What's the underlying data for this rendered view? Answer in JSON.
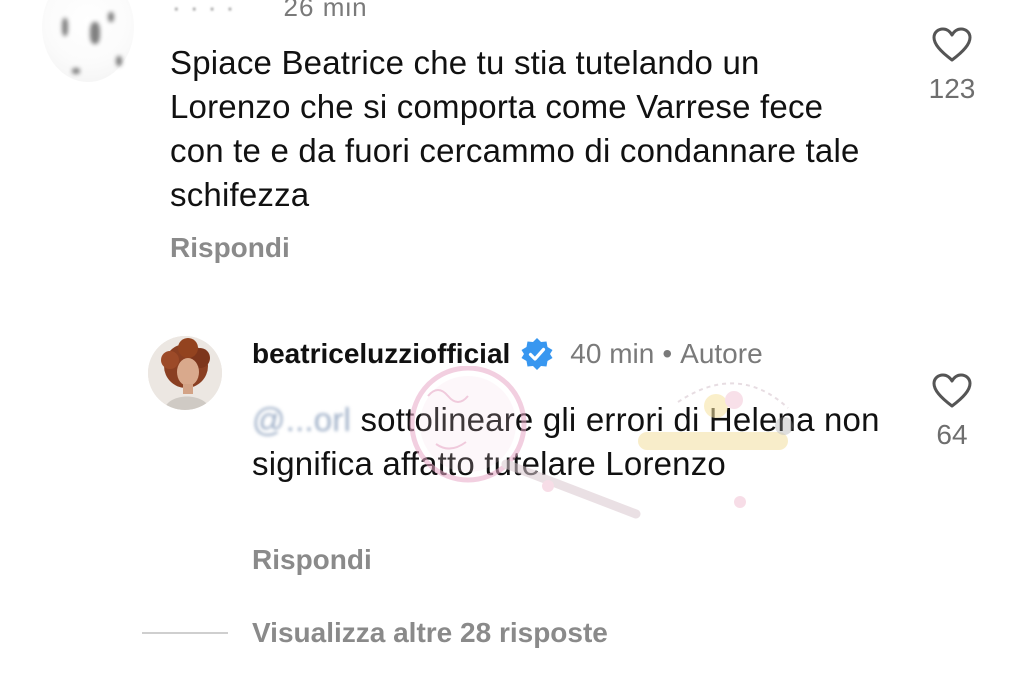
{
  "comment1": {
    "time": "26 min",
    "text": "Spiace Beatrice che tu stia tutelando un Lorenzo che si comporta come Varrese fece con te e da fuori cercammo di condannare tale schifezza",
    "reply_label": "Rispondi",
    "likes": "123",
    "like_icon": "heart-outline-icon"
  },
  "comment2": {
    "username": "beatriceluzziofficial",
    "verified_icon": "verified-badge-icon",
    "time": "40 min",
    "separator": "•",
    "author_label": "Autore",
    "mention": "@...orl",
    "text": "sottolineare gli errori di Helena non significa affatto tutelare Lorenzo",
    "reply_label": "Rispondi",
    "likes": "64",
    "like_icon": "heart-outline-icon"
  },
  "more_replies": "Visualizza altre 28 risposte",
  "colors": {
    "text": "#111111",
    "secondary": "#7a7a7a",
    "verified": "#3897f0",
    "watermark": "#e9a9c8"
  }
}
